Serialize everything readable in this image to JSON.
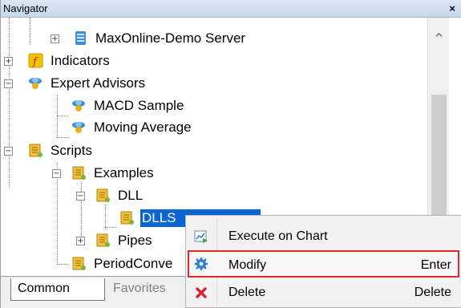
{
  "window": {
    "title": "Navigator",
    "close_glyph": "×"
  },
  "tree": {
    "server": "MaxOnline-Demo Server",
    "indicators": "Indicators",
    "expert_advisors": "Expert Advisors",
    "macd_sample": "MACD Sample",
    "moving_average": "Moving Average",
    "scripts": "Scripts",
    "examples": "Examples",
    "dll": "DLL",
    "dll_sample": "DLLS",
    "pipes": "Pipes",
    "period_converter": "PeriodConve"
  },
  "scrollbar": {
    "up_glyph": "^"
  },
  "tabs": [
    {
      "label": "Common"
    },
    {
      "label": "Favorites"
    }
  ],
  "context_menu": {
    "items": [
      {
        "label": "Execute on Chart",
        "shortcut": "",
        "icon": "execute-chart-icon"
      },
      {
        "label": "Modify",
        "shortcut": "Enter",
        "icon": "gear-icon",
        "highlighted": true
      },
      {
        "label": "Delete",
        "shortcut": "Delete",
        "icon": "delete-x-icon"
      }
    ]
  },
  "colors": {
    "selection": "#0a64d4",
    "highlight_border": "#e5262a",
    "script_icon": "#e8b020",
    "indicator_icon": "#f2c200",
    "advisor_icon": "#3c8fd6"
  }
}
